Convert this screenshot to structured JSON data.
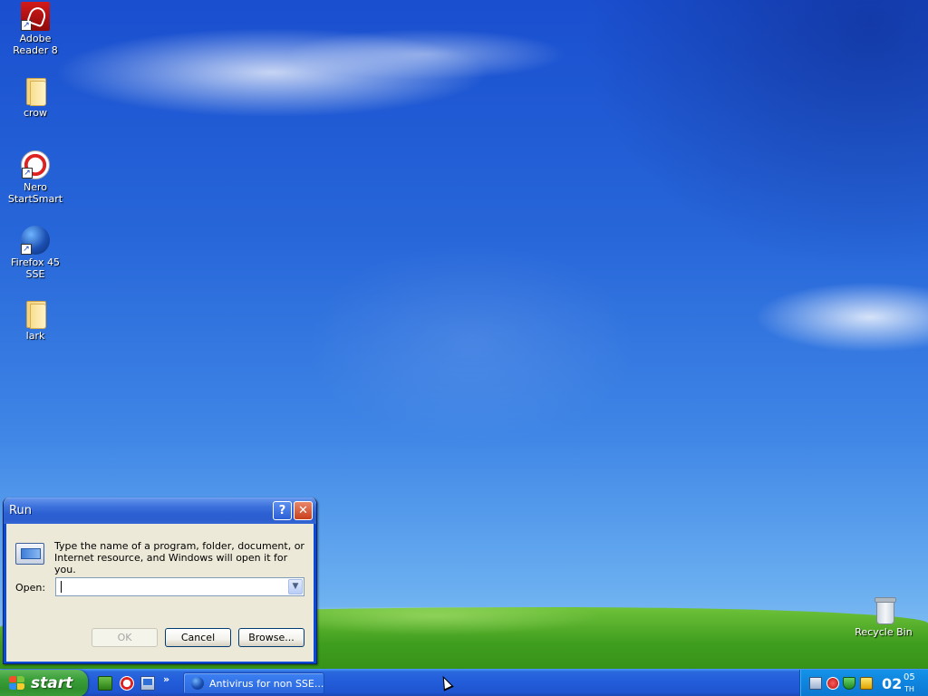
{
  "desktop": {
    "icons": [
      {
        "label": "Adobe Reader 8",
        "icon": "pdf-icon"
      },
      {
        "label": "crow",
        "icon": "folder-icon"
      },
      {
        "label": "Nero StartSmart",
        "icon": "nero-icon"
      },
      {
        "label": "Firefox 45 SSE",
        "icon": "firefox-icon"
      },
      {
        "label": "lark",
        "icon": "folder-icon"
      },
      {
        "label": "Recycle Bin",
        "icon": "recycle-bin-icon"
      }
    ]
  },
  "run_dialog": {
    "title": "Run",
    "help_glyph": "?",
    "close_glyph": "✕",
    "description": "Type the name of a program, folder, document, or Internet resource, and Windows will open it for you.",
    "open_label": "Open:",
    "open_value": "",
    "combo_glyph": "▼",
    "ok_label": "OK",
    "cancel_label": "Cancel",
    "browse_label": "Browse..."
  },
  "taskbar": {
    "start_label": "start",
    "quicklaunch_more": "»",
    "task_button_label": "Antivirus for non SSE...",
    "clock_hour": "02",
    "clock_minute": "05",
    "clock_suffix": "TH"
  }
}
